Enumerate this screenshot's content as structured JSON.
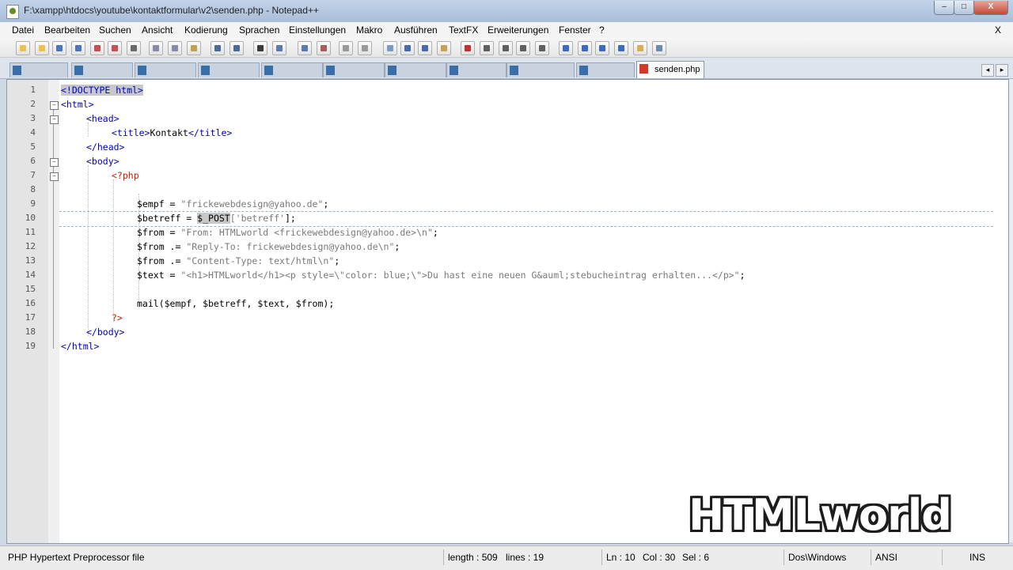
{
  "window": {
    "title": "F:\\xampp\\htdocs\\youtube\\kontaktformular\\v2\\senden.php - Notepad++",
    "minimize": "–",
    "maximize": "□",
    "close": "X"
  },
  "menu": [
    "Datei",
    "Bearbeiten",
    "Suchen",
    "Ansicht",
    "Kodierung",
    "Sprachen",
    "Einstellungen",
    "Makro",
    "Ausführen",
    "TextFX",
    "Erweiterungen",
    "Fenster",
    "?"
  ],
  "menu_close": "X",
  "toolbar_icons": [
    "new-file-icon",
    "open-file-icon",
    "save-icon",
    "save-all-icon",
    "close-icon",
    "close-all-icon",
    "print-icon",
    "cut-icon",
    "copy-icon",
    "paste-icon",
    "undo-icon",
    "redo-icon",
    "find-icon",
    "replace-icon",
    "zoom-in-icon",
    "zoom-out-icon",
    "sync-vertical-icon",
    "sync-horizontal-icon",
    "word-wrap-icon",
    "show-all-chars-icon",
    "indent-guide-icon",
    "user-language-icon",
    "record-macro-icon",
    "stop-record-icon",
    "play-macro-icon",
    "play-multiple-icon",
    "save-macro-icon",
    "tfx-icon-1",
    "tfx-icon-2",
    "tfx-icon-3",
    "tfx-icon-4",
    "folder-icon",
    "spellcheck-icon"
  ],
  "tabs": {
    "active_label": "senden.php"
  },
  "editor": {
    "line_numbers": [
      "1",
      "2",
      "3",
      "4",
      "5",
      "6",
      "7",
      "8",
      "9",
      "10",
      "11",
      "12",
      "13",
      "14",
      "15",
      "16",
      "17",
      "18",
      "19"
    ],
    "cursor_line": 10
  },
  "code": {
    "l1": "<!DOCTYPE html>",
    "l2": "<html>",
    "l3": "<head>",
    "l4_open": "<title>",
    "l4_text": "Kontakt",
    "l4_close": "</title>",
    "l5": "</head>",
    "l6": "<body>",
    "l7": "<?php",
    "l9_var": "$empf = ",
    "l9_str": "\"frickewebdesign@yahoo.de\"",
    "l9_end": ";",
    "l10_var": "$betreff = ",
    "l10_post": "$_POST",
    "l10_idx_open": "[",
    "l10_str": "'betreff'",
    "l10_end": "];",
    "l11_var": "$from = ",
    "l11_str": "\"From: HTMLworld <frickewebdesign@yahoo.de>\\n\"",
    "l11_end": ";",
    "l12_var": "$from .= ",
    "l12_str": "\"Reply-To: frickewebdesign@yahoo.de\\n\"",
    "l12_end": ";",
    "l13_var": "$from .= ",
    "l13_str": "\"Content-Type: text/html\\n\"",
    "l13_end": ";",
    "l14_var": "$text = ",
    "l14_str": "\"<h1>HTMLworld</h1><p style=\\\"color: blue;\\\">Du hast eine neuen G&auml;stebucheintrag erhalten...</p>\"",
    "l14_end": ";",
    "l16": "mail($empf, $betreff, $text, $from);",
    "l17": "?>",
    "l18": "</body>",
    "l19": "</html>"
  },
  "status": {
    "filetype": "PHP Hypertext Preprocessor file",
    "length": "length : 509",
    "lines": "lines : 19",
    "ln": "Ln : 10",
    "col": "Col : 30",
    "sel": "Sel : 6",
    "eol": "Dos\\Windows",
    "encoding": "ANSI",
    "mode": "INS"
  },
  "watermark": "HTMLworld",
  "colors": {
    "tag": "#0000c8",
    "php": "#c81e00",
    "string": "#7a7a7a"
  }
}
